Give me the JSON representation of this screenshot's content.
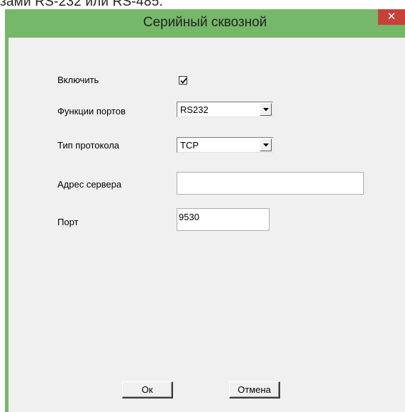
{
  "background_text": "зами RS-232 или RS-485.",
  "window": {
    "title": "Серийный сквозной",
    "close_glyph": "✕"
  },
  "form": {
    "enable_label": "Включить",
    "enable_checked": true,
    "port_function_label": "Функции портов",
    "port_function_value": "RS232",
    "protocol_type_label": "Тип протокола",
    "protocol_type_value": "TCP",
    "server_address_label": "Адрес сервера",
    "server_address_value": "",
    "port_label": "Порт",
    "port_value": "9530"
  },
  "buttons": {
    "ok": "Ок",
    "cancel": "Отмена"
  },
  "colors": {
    "title_bar": "#76b869",
    "close_button": "#c7413a",
    "dialog_body": "#f0f0f0"
  }
}
